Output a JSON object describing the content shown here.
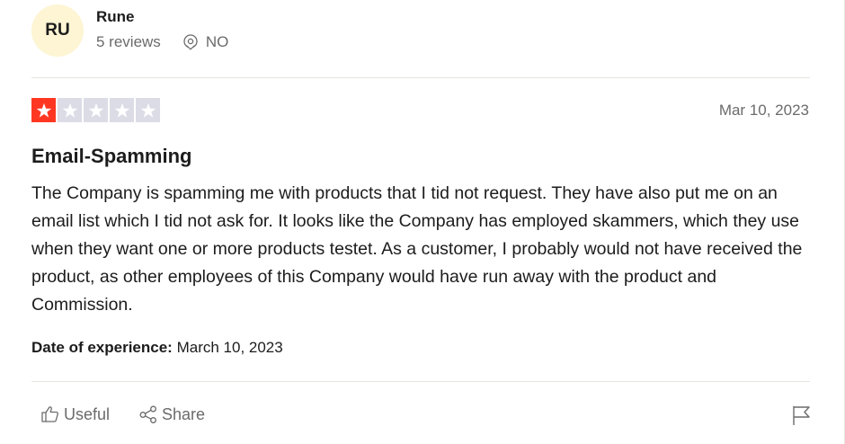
{
  "consumer": {
    "initials": "RU",
    "name": "Rune",
    "reviews": "5 reviews",
    "country": "NO"
  },
  "review": {
    "rating": 1,
    "max_rating": 5,
    "date": "Mar 10, 2023",
    "title": "Email-Spamming",
    "body": "The Company is spamming me with products that I tid not request. They have also put me on an email list which I tid not ask for. It looks like the Company has employed skammers, which they use when they want one or more products testet. As a customer, I probably would not have received the product, as other employees of this Company would have run away with the product and Commission.",
    "experience_label": "Date of experience:",
    "experience_date": "March 10, 2023"
  },
  "actions": {
    "useful_label": "Useful",
    "share_label": "Share"
  },
  "icons": {
    "location": "location-pin-icon",
    "useful": "thumbs-up-icon",
    "share": "share-icon",
    "flag": "flag-icon",
    "star": "star-icon"
  },
  "colors": {
    "star_filled": "#ff3722",
    "star_empty": "#dcdce6",
    "avatar_bg": "#fdf5d3",
    "muted_text": "#6b6b6b"
  }
}
